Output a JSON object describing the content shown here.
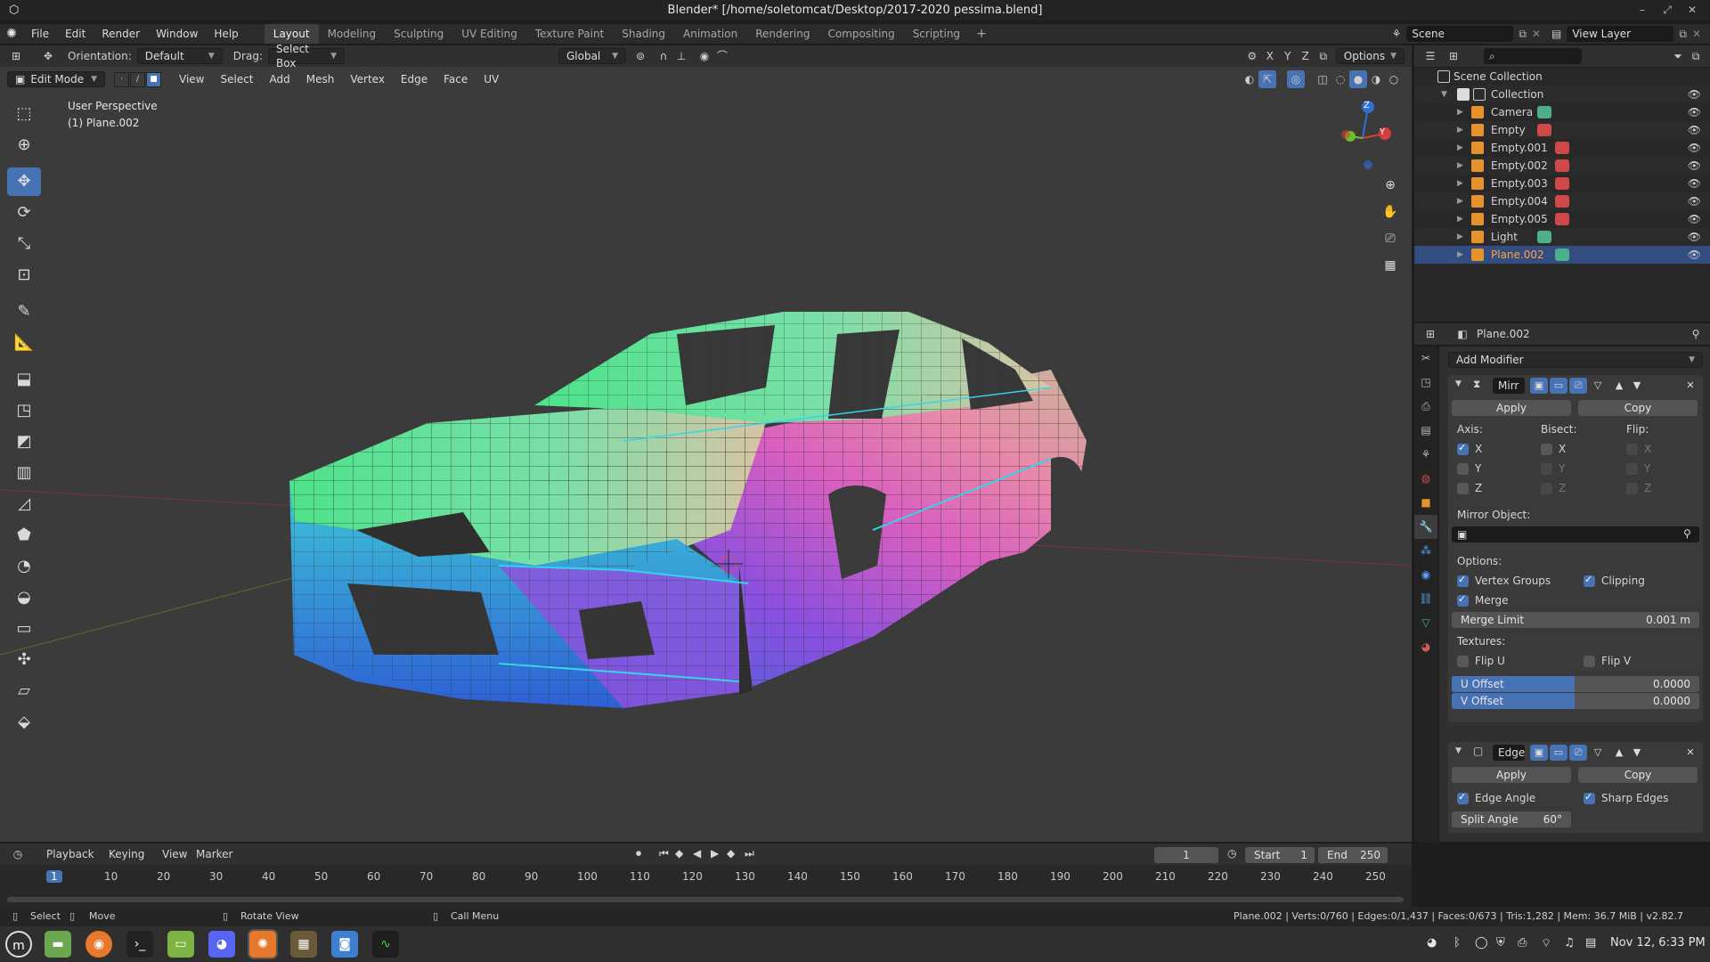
{
  "window": {
    "title": "Blender* [/home/soletomcat/Desktop/2017-2020 pessima.blend]",
    "controls": [
      "–",
      "⤢",
      "✕"
    ]
  },
  "menubar": {
    "items": [
      "File",
      "Edit",
      "Render",
      "Window",
      "Help"
    ],
    "workspaces": [
      "Layout",
      "Modeling",
      "Sculpting",
      "UV Editing",
      "Texture Paint",
      "Shading",
      "Animation",
      "Rendering",
      "Compositing",
      "Scripting"
    ],
    "active_workspace": "Layout",
    "scene": "Scene",
    "view_layer": "View Layer"
  },
  "toolheader": {
    "orientation_label": "Orientation:",
    "orientation_value": "Default",
    "drag_label": "Drag:",
    "drag_value": "Select Box",
    "transform_value": "Global",
    "options_label": "Options"
  },
  "viewport_header": {
    "mode": "Edit Mode",
    "menus": [
      "View",
      "Select",
      "Add",
      "Mesh",
      "Vertex",
      "Edge",
      "Face",
      "UV"
    ]
  },
  "viewport": {
    "perspective_label": "User Perspective",
    "object_label": "(1) Plane.002",
    "gizmo": {
      "z": "Z",
      "y": "Y"
    }
  },
  "outliner": {
    "root": "Scene Collection",
    "collection": "Collection",
    "items": [
      {
        "name": "Camera",
        "icon_color": "#4cb08a"
      },
      {
        "name": "Empty",
        "icon_color": "#d04848"
      },
      {
        "name": "Empty.001",
        "icon_color": "#d04848"
      },
      {
        "name": "Empty.002",
        "icon_color": "#d04848"
      },
      {
        "name": "Empty.003",
        "icon_color": "#d04848"
      },
      {
        "name": "Empty.004",
        "icon_color": "#d04848"
      },
      {
        "name": "Empty.005",
        "icon_color": "#d04848"
      },
      {
        "name": "Light",
        "icon_color": "#4cb08a"
      },
      {
        "name": "Plane.002",
        "icon_color": "#4cb08a",
        "selected": true
      }
    ]
  },
  "properties": {
    "object_name": "Plane.002",
    "add_modifier": "Add Modifier",
    "mirror": {
      "name": "Mirr",
      "apply": "Apply",
      "copy": "Copy",
      "axis_label": "Axis:",
      "bisect_label": "Bisect:",
      "flip_label": "Flip:",
      "axes": [
        "X",
        "Y",
        "Z"
      ],
      "axis_checked": [
        true,
        false,
        false
      ],
      "mirror_object_label": "Mirror Object:",
      "options_label": "Options:",
      "vertex_groups": "Vertex Groups",
      "clipping": "Clipping",
      "merge": "Merge",
      "merge_limit_label": "Merge Limit",
      "merge_limit_value": "0.001 m",
      "textures_label": "Textures:",
      "flip_u": "Flip U",
      "flip_v": "Flip V",
      "u_offset_label": "U Offset",
      "u_offset_value": "0.0000",
      "v_offset_label": "V Offset",
      "v_offset_value": "0.0000"
    },
    "edge_split": {
      "name": "Edge",
      "apply": "Apply",
      "copy": "Copy",
      "edge_angle": "Edge Angle",
      "sharp_edges": "Sharp Edges",
      "split_angle_label": "Split Angle",
      "split_angle_value": "60°"
    }
  },
  "timeline": {
    "menus": [
      "Playback",
      "Keying",
      "View",
      "Marker"
    ],
    "current_frame": "1",
    "start_label": "Start",
    "start_value": "1",
    "end_label": "End",
    "end_value": "250",
    "ticks": [
      "1",
      "10",
      "20",
      "30",
      "40",
      "50",
      "60",
      "70",
      "80",
      "90",
      "100",
      "110",
      "120",
      "130",
      "140",
      "150",
      "160",
      "170",
      "180",
      "190",
      "200",
      "210",
      "220",
      "230",
      "240",
      "250"
    ]
  },
  "statusbar": {
    "select": "Select",
    "move": "Move",
    "rotate": "Rotate View",
    "call_menu": "Call Menu",
    "stats": "Plane.002 | Verts:0/760 | Edges:0/1,437 | Faces:0/673 | Tris:1,282 | Mem: 36.7 MiB | v2.82.7"
  },
  "taskbar": {
    "datetime": "Nov 12, 6:33 PM"
  }
}
